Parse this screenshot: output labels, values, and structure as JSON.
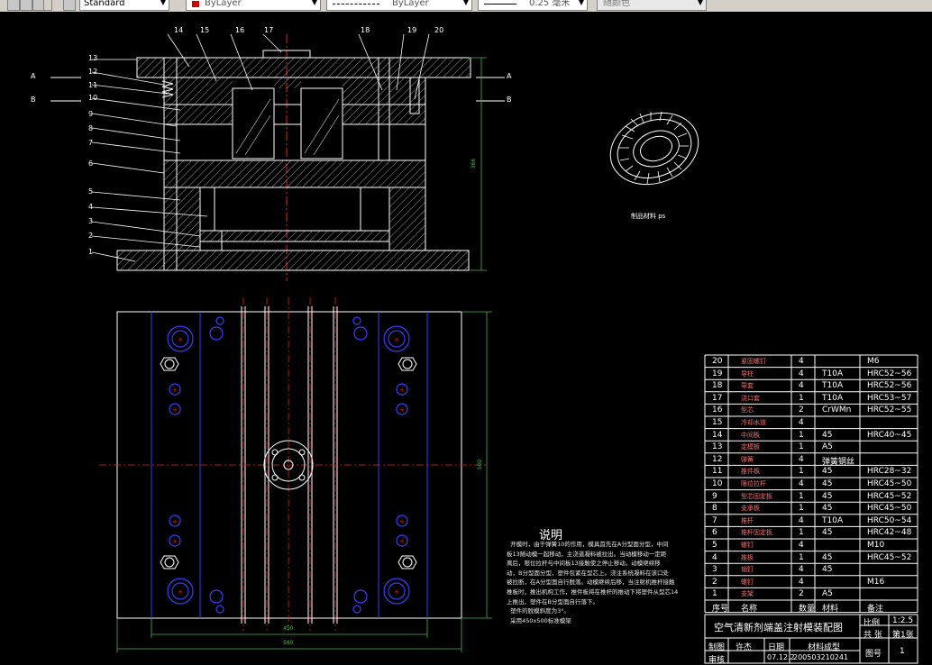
{
  "toolbar": {
    "text_style": "Standard",
    "color": "ByLayer",
    "linetype": "ByLayer",
    "lineweight": "0.25 毫米",
    "plot_style": "随颜色",
    "color_swatch": "#d40000"
  },
  "section_view": {
    "top_labels": [
      "14",
      "15",
      "16",
      "17",
      "18",
      "19",
      "20"
    ],
    "left_labels": [
      "13",
      "12",
      "11",
      "10",
      "9",
      "8",
      "7",
      "6",
      "5",
      "4",
      "3",
      "2",
      "1"
    ],
    "section_markers": [
      "A",
      "B",
      "A",
      "B"
    ],
    "height_dim": "366"
  },
  "plan_view": {
    "width_dim_inner": "450",
    "width_dim_outer": "580",
    "height_dim": "500"
  },
  "product": {
    "caption": "制品材料  ps"
  },
  "notes": {
    "title": "说明",
    "body": "  开模时，由于弹簧10的作用，模具首先在A分型面分型，中间\n板13随动模一起移动，主浇道凝料被拉出。当动模移动一定距\n离后，限位拉杆与中间板13接触使之停止移动。动模继续移\n动，B分型面分型，塑件包紧在型芯上。浇注系统凝料在该口处\n被拉断，在A分型面自行脱落。动模继续后移，当注射机推杆接触\n推板时，推出机构工作，推件板将在推杆的推动下将塑件从型芯14\n上推出，塑件在B分型面自行落下。\n  塑件的脱模斜度为3°。\n  采用450x500标准模架"
  },
  "bom": {
    "rows": [
      {
        "no": "20",
        "name": "紧固螺钉",
        "qty": "4",
        "mat": "",
        "note": "M6"
      },
      {
        "no": "19",
        "name": "导柱",
        "qty": "4",
        "mat": "T10A",
        "note": "HRC52~56"
      },
      {
        "no": "18",
        "name": "导套",
        "qty": "4",
        "mat": "T10A",
        "note": "HRC52~56"
      },
      {
        "no": "17",
        "name": "浇口套",
        "qty": "1",
        "mat": "T10A",
        "note": "HRC53~57"
      },
      {
        "no": "16",
        "name": "型芯",
        "qty": "2",
        "mat": "CrWMn",
        "note": "HRC52~55"
      },
      {
        "no": "15",
        "name": "冷却水道",
        "qty": "4",
        "mat": "",
        "note": ""
      },
      {
        "no": "14",
        "name": "中间板",
        "qty": "1",
        "mat": "45",
        "note": "HRC40~45"
      },
      {
        "no": "13",
        "name": "定模板",
        "qty": "1",
        "mat": "A5",
        "note": ""
      },
      {
        "no": "12",
        "name": "弹簧",
        "qty": "4",
        "mat": "弹簧钢丝",
        "note": ""
      },
      {
        "no": "11",
        "name": "推件板",
        "qty": "1",
        "mat": "45",
        "note": "HRC28~32"
      },
      {
        "no": "10",
        "name": "限位拉杆",
        "qty": "4",
        "mat": "45",
        "note": "HRC45~50"
      },
      {
        "no": "9",
        "name": "型芯固定板",
        "qty": "1",
        "mat": "45",
        "note": "HRC45~52"
      },
      {
        "no": "8",
        "name": "支承板",
        "qty": "1",
        "mat": "45",
        "note": "HRC45~50"
      },
      {
        "no": "7",
        "name": "推杆",
        "qty": "4",
        "mat": "T10A",
        "note": "HRC50~54"
      },
      {
        "no": "6",
        "name": "推杆固定板",
        "qty": "1",
        "mat": "45",
        "note": "HRC42~48"
      },
      {
        "no": "5",
        "name": "螺钉",
        "qty": "4",
        "mat": "",
        "note": "M10"
      },
      {
        "no": "4",
        "name": "推板",
        "qty": "1",
        "mat": "45",
        "note": "HRC45~52"
      },
      {
        "no": "3",
        "name": "销钉",
        "qty": "4",
        "mat": "45",
        "note": ""
      },
      {
        "no": "2",
        "name": "螺钉",
        "qty": "4",
        "mat": "",
        "note": "M16"
      },
      {
        "no": "1",
        "name": "支架",
        "qty": "2",
        "mat": "A5",
        "note": ""
      }
    ],
    "header": {
      "no": "序号",
      "name": "名称",
      "qty": "数量",
      "mat": "材料",
      "note": "备注"
    }
  },
  "title_block": {
    "title": "空气清新剂端盖注射模装配图",
    "scale_label": "比例",
    "scale": "1:2.5",
    "sheets_total": "共 张",
    "sheet_no": "第1张",
    "drawn_label": "制图",
    "drawn_by": "许杰",
    "date_label": "日期",
    "date": "07.12.2",
    "class_label": "材料成型",
    "student_id": "200503210241",
    "check_label": "审核",
    "drawing_no_label": "图号",
    "drawing_no": "1"
  }
}
